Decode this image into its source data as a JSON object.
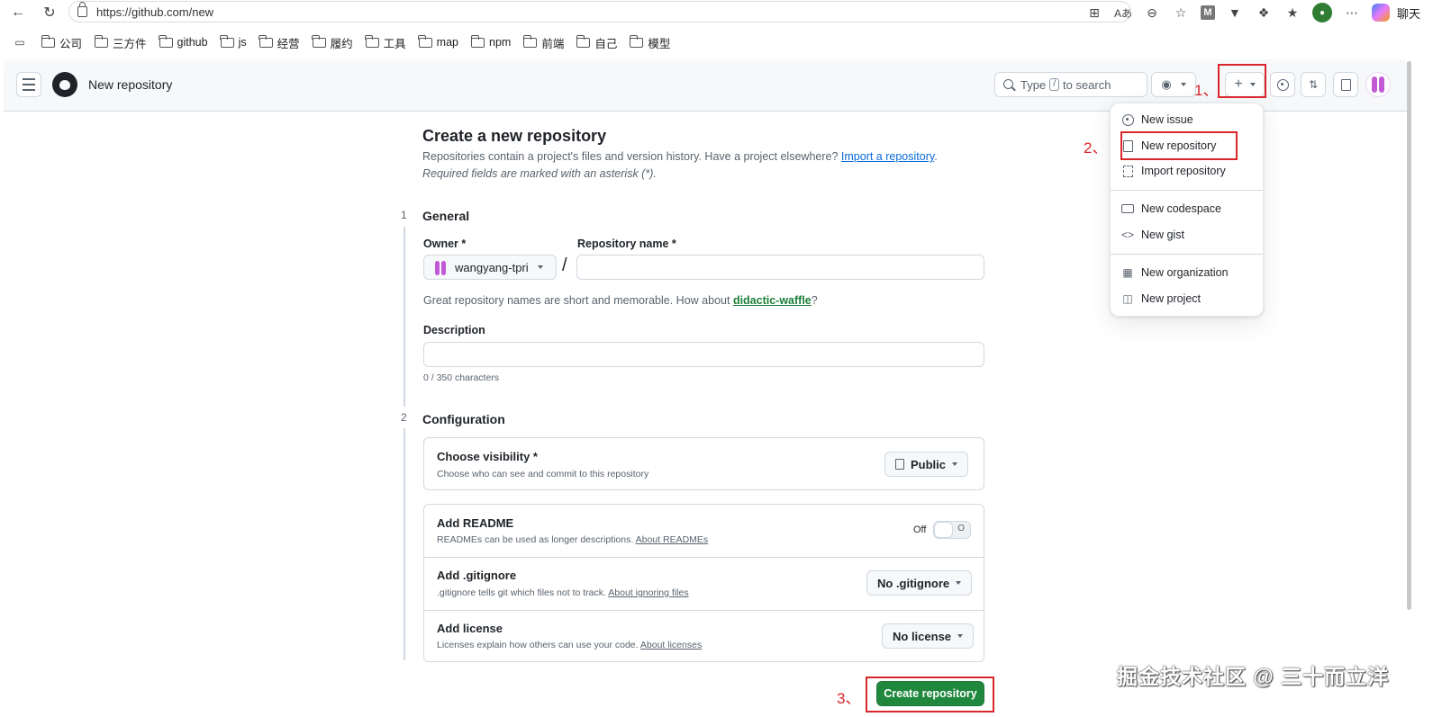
{
  "browser": {
    "url": "https://github.com/new",
    "chat_label": "聊天",
    "bookmarks": [
      "公司",
      "三方件",
      "github",
      "js",
      "经营",
      "履约",
      "工具",
      "map",
      "npm",
      "前端",
      "自己",
      "模型"
    ]
  },
  "header": {
    "title": "New repository",
    "search_type": "Type",
    "search_key": "/",
    "search_rest": "to search"
  },
  "form": {
    "heading": "Create a new repository",
    "intro_text": "Repositories contain a project's files and version history. Have a project elsewhere?",
    "intro_link": "Import a repository",
    "intro_end": ".",
    "required_note": "Required fields are marked with an asterisk (*).",
    "general": {
      "step": "1",
      "title": "General",
      "owner_label": "Owner *",
      "owner_value": "wangyang-tpri",
      "slash": "/",
      "repo_name_label": "Repository name *",
      "name_hint_prefix": "Great repository names are short and memorable. How about",
      "name_hint_suggestion": "didactic-waffle",
      "name_hint_suffix": "?",
      "description_label": "Description",
      "char_count": "0 / 350 characters"
    },
    "configuration": {
      "step": "2",
      "title": "Configuration",
      "visibility_title": "Choose visibility *",
      "visibility_desc": "Choose who can see and commit to this repository",
      "visibility_value": "Public",
      "readme_title": "Add README",
      "readme_desc": "READMEs can be used as longer descriptions.",
      "readme_link": "About READMEs",
      "readme_toggle_label": "Off",
      "readme_toggle_glyph": "O",
      "gitignore_title": "Add .gitignore",
      "gitignore_desc": ".gitignore tells git which files not to track.",
      "gitignore_link": "About ignoring files",
      "gitignore_value": "No .gitignore",
      "license_title": "Add license",
      "license_desc": "Licenses explain how others can use your code.",
      "license_link": "About licenses",
      "license_value": "No license"
    },
    "create_button": "Create repository"
  },
  "menu": {
    "items": [
      {
        "label": "New issue",
        "icon": "issue-icon"
      },
      {
        "label": "New repository",
        "icon": "repo-icon"
      },
      {
        "label": "Import repository",
        "icon": "repo-push-icon"
      },
      {
        "label": "New codespace",
        "icon": "codespaces-icon"
      },
      {
        "label": "New gist",
        "icon": "code-icon"
      },
      {
        "label": "New organization",
        "icon": "organization-icon"
      },
      {
        "label": "New project",
        "icon": "project-icon"
      }
    ]
  },
  "annotations": {
    "step1": "1、",
    "step2": "2、",
    "step3": "3、",
    "color": "#d9262b"
  },
  "watermark": "掘金技术社区 @ 三十而立洋",
  "colors": {
    "primary_button": "#1f883d",
    "link": "#0969da",
    "suggestion": "#1a7f37"
  }
}
